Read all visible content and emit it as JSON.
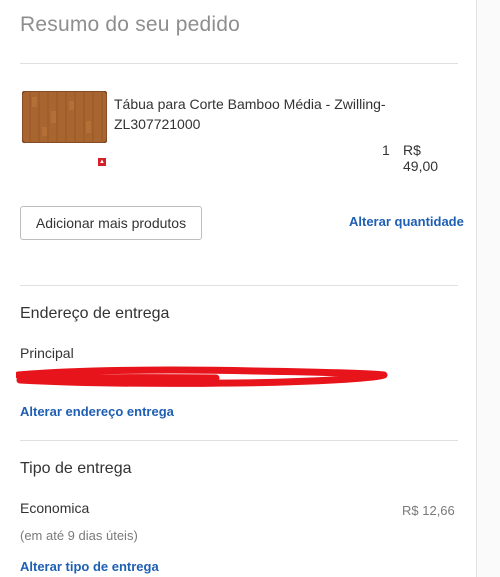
{
  "order_summary": {
    "title": "Resumo do seu pedido"
  },
  "product": {
    "image_icon": "cutting-board-image",
    "brand_icon": "zwilling-logo-icon",
    "name": "Tábua para Corte Bamboo Média - Zwilling-ZL307721000",
    "quantity": "1",
    "price": "R$ 49,00"
  },
  "actions": {
    "add_products_label": "Adicionar mais produtos",
    "change_quantity_label": "Alterar quantidade"
  },
  "delivery_address": {
    "title": "Endereço de entrega",
    "address_name": "Principal",
    "change_label": "Alterar endereço entrega"
  },
  "delivery_type": {
    "title": "Tipo de entrega",
    "option_name": "Economica",
    "option_eta": "(em até 9 dias úteis)",
    "option_price": "R$ 12,66",
    "change_label": "Alterar tipo de entrega"
  },
  "colors": {
    "link": "#1e5fb3",
    "title": "#8e8e8e",
    "redaction": "#e8141c",
    "wood": "#a8652f"
  }
}
